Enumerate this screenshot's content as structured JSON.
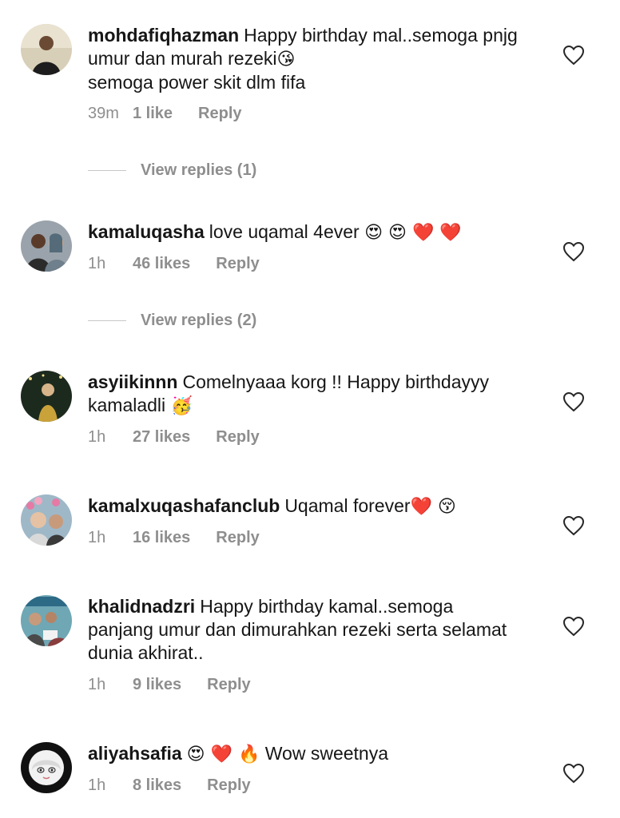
{
  "comments": [
    {
      "username": "mohdafiqhazman",
      "text": "Happy birthday mal..semoga pnjg umur dan murah rezeki",
      "emoji": "😘",
      "text_after": "semoga power skit dlm fifa",
      "time": "39m",
      "likes": "1 like",
      "reply": "Reply",
      "avatar_icon": "avatar-photo"
    },
    {
      "username": "kamaluqasha",
      "text": "love uqamal 4ever",
      "emoji": "😍 😍 ❤️ ❤️",
      "time": "1h",
      "likes": "46 likes",
      "reply": "Reply",
      "avatar_icon": "avatar-photo"
    },
    {
      "username": "asyiikinnn",
      "text": "Comelnyaaa korg !! Happy birthdayyy kamaladli",
      "emoji": "🥳",
      "time": "1h",
      "likes": "27 likes",
      "reply": "Reply",
      "avatar_icon": "avatar-photo"
    },
    {
      "username": "kamalxuqashafanclub",
      "text": "Uqamal forever",
      "emoji": "❤️ 😚",
      "time": "1h",
      "likes": "16 likes",
      "reply": "Reply",
      "avatar_icon": "avatar-photo"
    },
    {
      "username": "khalidnadzri",
      "text": "Happy birthday kamal..semoga panjang umur dan dimurahkan rezeki serta selamat dunia akhirat..",
      "emoji": "",
      "time": "1h",
      "likes": "9 likes",
      "reply": "Reply",
      "avatar_icon": "avatar-photo"
    },
    {
      "username": "aliyahsafia",
      "emoji_before": "😍 ❤️ 🔥",
      "text": "Wow sweetnya",
      "emoji": "",
      "time": "1h",
      "likes": "8 likes",
      "reply": "Reply",
      "avatar_icon": "avatar-cartoon"
    }
  ],
  "view_replies": [
    "View replies (1)",
    "View replies (2)"
  ],
  "colors": {
    "text": "#161616",
    "muted": "#8e8e8e",
    "divider": "#c7c7c7",
    "background": "#ffffff"
  }
}
